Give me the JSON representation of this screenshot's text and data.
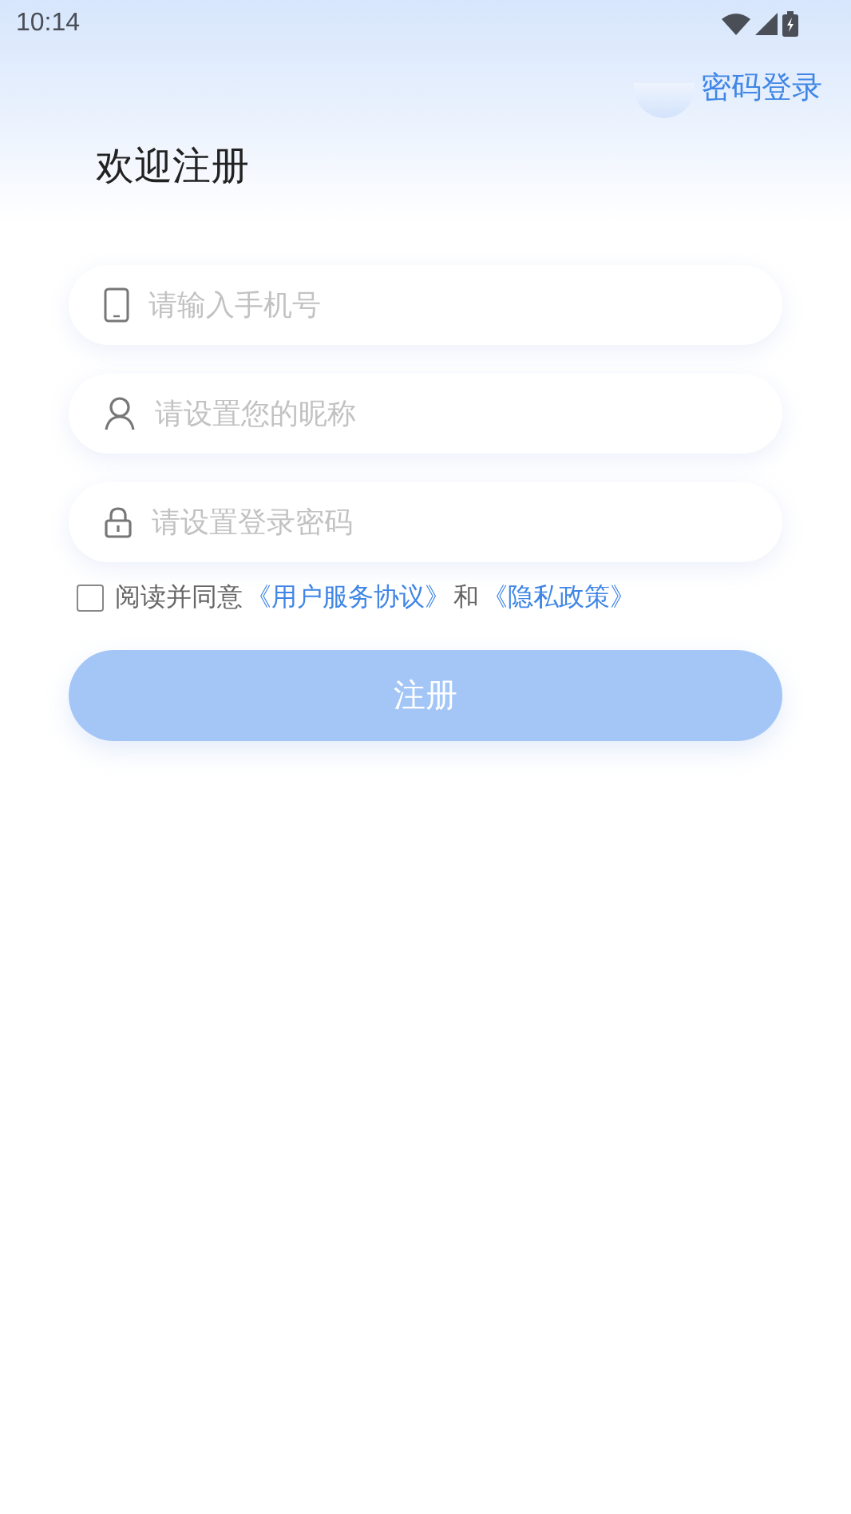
{
  "status_bar": {
    "time": "10:14"
  },
  "header": {
    "switch_link": "密码登录",
    "title": "欢迎注册"
  },
  "fields": [
    {
      "kind": "phone",
      "placeholder": "请输入手机号"
    },
    {
      "kind": "user",
      "placeholder": "请设置您的昵称"
    },
    {
      "kind": "lock",
      "placeholder": "请设置登录密码"
    }
  ],
  "agreement": {
    "checked": false,
    "parts": [
      {
        "kind": "text",
        "text": "阅读并同意"
      },
      {
        "kind": "link",
        "text": "《用户服务协议》"
      },
      {
        "kind": "text",
        "text": "和"
      },
      {
        "kind": "link",
        "text": "《隐私政策》"
      }
    ]
  },
  "submit_button": {
    "label": "注册",
    "disabled": true
  }
}
